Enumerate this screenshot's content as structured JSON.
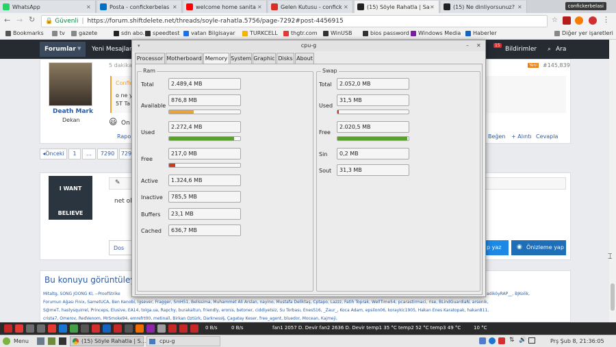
{
  "browser": {
    "tabs": [
      {
        "title": "WhatsApp",
        "color": "#25d366",
        "icon": "whatsapp-icon"
      },
      {
        "title": "Posta - confickerbelas",
        "color": "#0072c6",
        "icon": "outlook-icon"
      },
      {
        "title": "welcome home sanita",
        "color": "#ff0000",
        "icon": "youtube-icon"
      },
      {
        "title": "Gelen Kutusu - confick",
        "color": "#d93025",
        "icon": "gmail-icon"
      },
      {
        "title": "(15) Söyle Rahatla | Sa",
        "color": "#222222",
        "icon": "shiftdelete-icon",
        "active": true
      },
      {
        "title": "(15) Ne dinliyorsunuz?",
        "color": "#222222",
        "icon": "shiftdelete-icon"
      }
    ],
    "profile": "confickerbelasi",
    "security_label": "Güvenli",
    "url": "https://forum.shiftdelete.net/threads/soyle-rahatla.5756/page-7292#post-4456915",
    "bookmarks": [
      {
        "label": "Bookmarks",
        "color": "#555555"
      },
      {
        "label": "tv",
        "color": "#888888"
      },
      {
        "label": "gazete",
        "color": "#888888"
      },
      {
        "label": "sdn abo.",
        "color": "#222222"
      },
      {
        "label": "speedtest",
        "color": "#333333"
      },
      {
        "label": "vatan Bilgisayar",
        "color": "#1a73e8"
      },
      {
        "label": "TURKCELL",
        "color": "#f4b400"
      },
      {
        "label": "thgtr.com",
        "color": "#e53935"
      },
      {
        "label": "WinUSB",
        "color": "#333333"
      },
      {
        "label": "bios password",
        "color": "#333333"
      },
      {
        "label": "Windows Media",
        "color": "#7b1fa2"
      },
      {
        "label": "Haberler",
        "color": "#1565c0"
      },
      {
        "label": "Diğer yer işaretleri",
        "color": "#888888"
      }
    ]
  },
  "forum": {
    "nav_forumlar": "Forumlar",
    "nav_yeni": "Yeni Mesajlar",
    "nav_bildirimler": "Bildirimler",
    "nav_ara": "Ara",
    "notif_count": "15",
    "post1": {
      "time": "5 dakika",
      "badge": "Yeni",
      "post_id": "#145,839",
      "username": "Death Mark",
      "rank": "Dekan",
      "quote_author": "Confic",
      "quote_line1": "o ne y",
      "quote_line2": "5T Ta",
      "emoji_text": "On",
      "report": "Rapo",
      "like": "Beğen",
      "quote_btn": "+ Alıntı",
      "reply": "Cevapla"
    },
    "pager": [
      "◂Önceki",
      "1",
      "...",
      "7290",
      "7291"
    ],
    "reply_text": "net ol",
    "banner_top": "I WANT",
    "banner_bottom": "BELIEVE",
    "draft_btn": "Dos",
    "send_btn": "p yaz",
    "preview_btn": "Önizleme yap",
    "viewers_title": "Bu konuyu görüntüley",
    "viewers_line1": "Mitaltg, SONG JOONG KI, --ProofStrike",
    "viewers_line1_right": "adiköyRAP__, BJKolik,",
    "viewers_line2": "Forumun Ağası Finix, SametUCA, Ben Kenobi, lgsever, Fragger, SmH51, Belissima, Muhammet Ali Arslan, nayino, Mustafa Deliktaş, Cptapo, Lazzz, Fatih Toprak, WellTime54, pcarastirmaci, rise, BLindGuardiaN, arsenik,",
    "viewers_line3": "S@meT, hastysquirrel, Princeps, Elusive, EA14, tolga.ua, Rapchy, burakaltun, friendly, eronis, betoner, ciddiyetsiz, Su Torbası, EnesS16, _Zaur_, Koca Adam, epsilon06, koraykic1905, Hakan Enes Karatopak, hakan811,",
    "viewers_line4": "crista7, Omerov, RedVenom, MrSmoke94, emrefrt00, metinall, Birkan Öztürk, Darkness§, Çagatay Keser, free_agent, bluedor, Mocean, Kajmeji,"
  },
  "cpug": {
    "title": "cpu-g",
    "tabs": [
      "Processor",
      "Motherboard",
      "Memory",
      "System",
      "Graphic",
      "Disks",
      "About"
    ],
    "active_tab": "Memory",
    "ram_title": "Ram",
    "swap_title": "Swap",
    "ram": {
      "total": {
        "label": "Total",
        "value": "2.489,4 MB"
      },
      "available": {
        "label": "Available",
        "value": "876,8 MB",
        "bar": 0.35,
        "color": "#e8a43a"
      },
      "used": {
        "label": "Used",
        "value": "2.272,4 MB",
        "bar": 0.91,
        "color": "#5aa02c"
      },
      "free": {
        "label": "Free",
        "value": "217,0 MB",
        "bar": 0.09,
        "color": "#d03a1c"
      },
      "active": {
        "label": "Active",
        "value": "1.324,6 MB"
      },
      "inactive": {
        "label": "Inactive",
        "value": "785,5 MB"
      },
      "buffers": {
        "label": "Buffers",
        "value": "23,1 MB"
      },
      "cached": {
        "label": "Cached",
        "value": "636,7 MB"
      }
    },
    "swap": {
      "total": {
        "label": "Total",
        "value": "2.052,0 MB"
      },
      "used": {
        "label": "Used",
        "value": "31,5 MB",
        "bar": 0.015,
        "color": "#d03a1c"
      },
      "free": {
        "label": "Free",
        "value": "2.020,5 MB",
        "bar": 0.985,
        "color": "#5aa02c"
      },
      "sin": {
        "label": "Sin",
        "value": "0,2 MB"
      },
      "sout": {
        "label": "Sout",
        "value": "31,3 MB"
      }
    }
  },
  "panel": {
    "net": "0 B/s",
    "net2": "0 B/s",
    "sensors": "fan1 2057 D. Devir fan2 2636 D. Devir temp1 35 °C temp2 52 °C temp3 49 °C",
    "temp": "10 °C"
  },
  "taskbar": {
    "menu": "Menu",
    "task1": "(15) Söyle Rahatla | S...",
    "task2": "cpu-g",
    "clock": "Prş Şub  8, 21:36:05"
  }
}
